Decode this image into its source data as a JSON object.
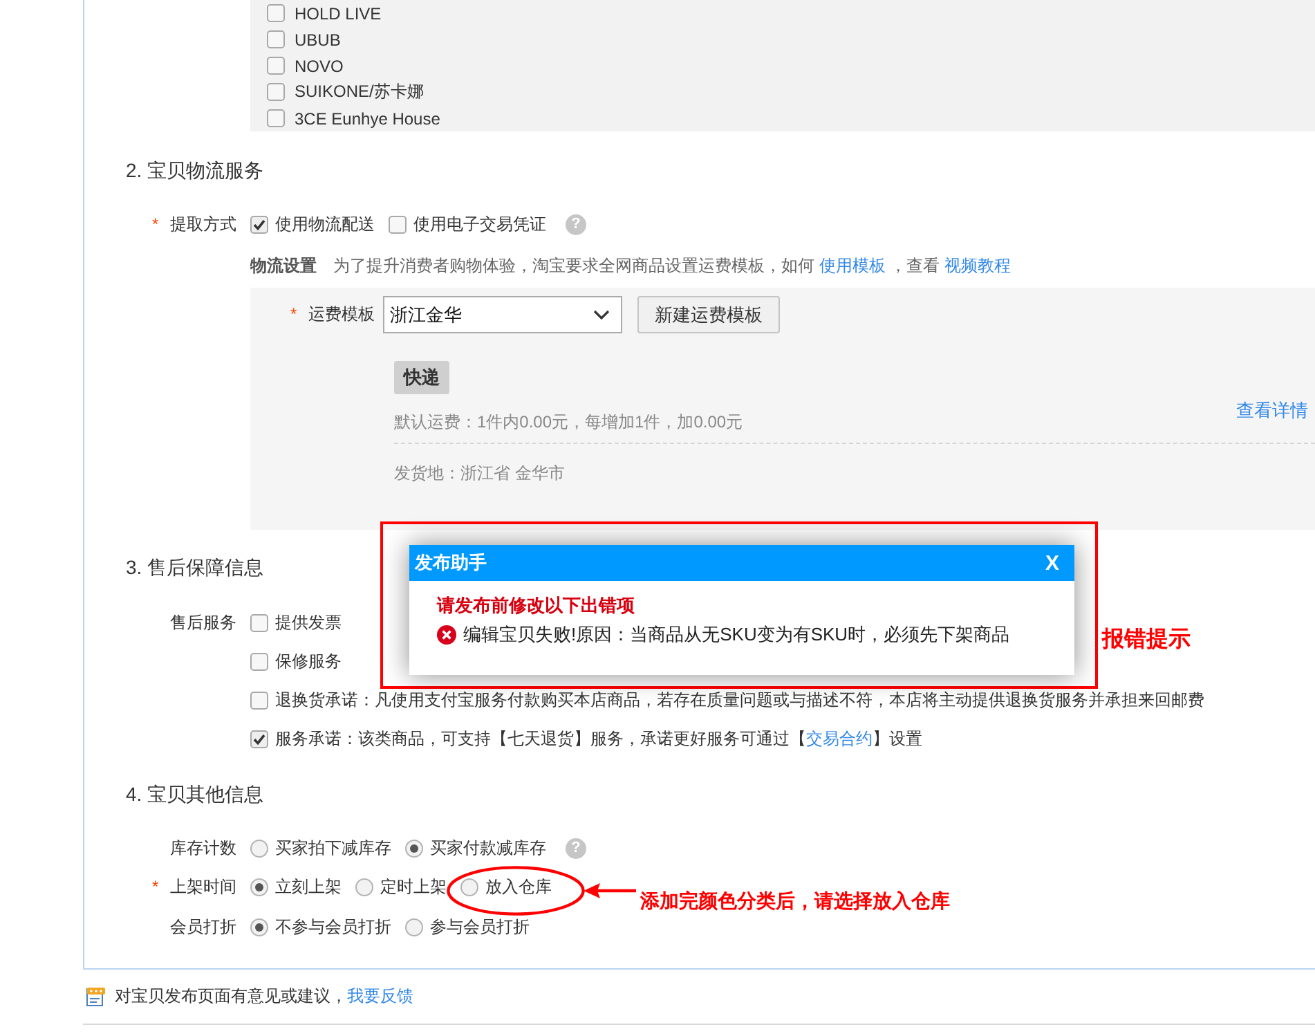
{
  "brand_list": {
    "items": [
      {
        "label": "HOLD LIVE",
        "checked": false
      },
      {
        "label": "UBUB",
        "checked": false
      },
      {
        "label": "NOVO",
        "checked": false
      },
      {
        "label": "SUIKONE/苏卡娜",
        "checked": false
      },
      {
        "label": "3CE Eunhye House",
        "checked": false
      }
    ]
  },
  "logistics": {
    "title": "2. 宝贝物流服务",
    "pickup": {
      "required_mark": "*",
      "label": "提取方式",
      "options": [
        {
          "label": "使用物流配送",
          "checked": true
        },
        {
          "label": "使用电子交易凭证",
          "checked": false
        }
      ],
      "help": "?"
    },
    "settings": {
      "label": "物流设置",
      "notice": [
        {
          "kind": "text",
          "text": "为了提升消费者购物体验，淘宝要求全网商品设置运费模板，如何 "
        },
        {
          "kind": "link",
          "text": "使用模板"
        },
        {
          "kind": "text",
          "text": " ，查看 "
        },
        {
          "kind": "link",
          "text": "视频教程"
        }
      ]
    },
    "template": {
      "required_mark": "*",
      "label": "运费模板",
      "value": "浙江金华",
      "button": "新建运费模板",
      "tabs": [
        {
          "label": "快递",
          "selected": true
        }
      ],
      "fee": "默认运费：1件内0.00元，每增加1件，加0.00元",
      "details_link": "查看详情",
      "origin": "发货地：浙江省 金华市"
    }
  },
  "after_sales": {
    "title": "3. 售后保障信息",
    "label": "售后服务",
    "options": [
      {
        "checked": false,
        "parts": [
          {
            "kind": "text",
            "text": "提供发票"
          }
        ]
      },
      {
        "checked": false,
        "parts": [
          {
            "kind": "text",
            "text": "保修服务"
          }
        ]
      },
      {
        "checked": false,
        "parts": [
          {
            "kind": "text",
            "text": "退换货承诺：凡使用支付宝服务付款购买本店商品，若存在质量问题或与描述不符，本店将主动提供退换货服务并承担来回邮费"
          }
        ]
      },
      {
        "checked": true,
        "parts": [
          {
            "kind": "text",
            "text": "服务承诺：该类商品，可支持【七天退货】服务，承诺更好服务可通过【"
          },
          {
            "kind": "link",
            "text": "交易合约"
          },
          {
            "kind": "text",
            "text": "】设置"
          }
        ]
      }
    ]
  },
  "other": {
    "title": "4. 宝贝其他信息",
    "rows": [
      {
        "label": "库存计数",
        "options": [
          {
            "label": "买家拍下减库存",
            "selected": false
          },
          {
            "label": "买家付款减库存",
            "selected": true
          }
        ],
        "help": "?"
      },
      {
        "required_mark": "*",
        "label": "上架时间",
        "options": [
          {
            "label": "立刻上架",
            "selected": true
          },
          {
            "label": "定时上架",
            "selected": false
          },
          {
            "label": "放入仓库",
            "selected": false
          }
        ]
      },
      {
        "label": "会员打折",
        "options": [
          {
            "label": "不参与会员打折",
            "selected": true
          },
          {
            "label": "参与会员打折",
            "selected": false
          }
        ]
      }
    ]
  },
  "feedback": {
    "parts": [
      {
        "kind": "text",
        "text": "对宝贝发布页面有意见或建议，"
      },
      {
        "kind": "link",
        "text": "我要反馈"
      }
    ]
  },
  "dialog": {
    "title": "发布助手",
    "close": "X",
    "heading": "请发布前修改以下出错项",
    "errors": [
      "编辑宝贝失败!原因：当商品从无SKU变为有SKU时，必须先下架商品"
    ]
  },
  "annotations": [
    {
      "kind": "box",
      "text": "报错提示"
    },
    {
      "kind": "ellipse_arrow",
      "text": "添加完颜色分类后，请选择放入仓库"
    }
  ]
}
